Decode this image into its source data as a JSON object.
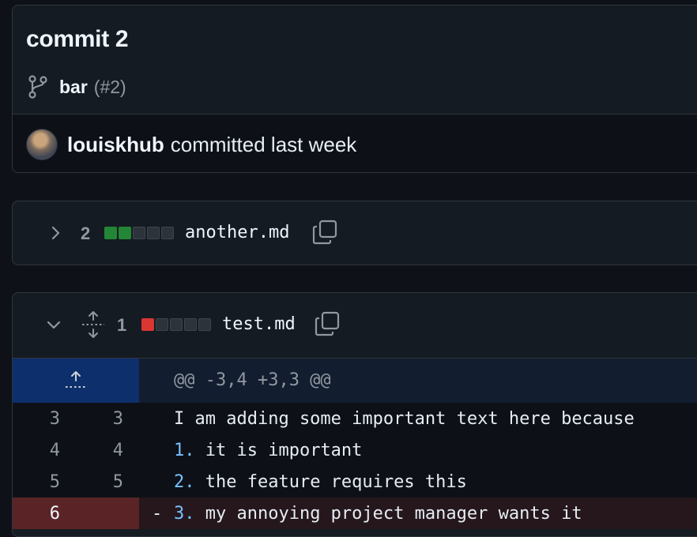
{
  "commit": {
    "title": "commit 2",
    "branch_name": "bar",
    "pr_ref": "(#2)",
    "author": "louiskhub",
    "action": "committed last week"
  },
  "files": [
    {
      "change_count": "2",
      "diffstat": [
        "add",
        "add",
        "neutral",
        "neutral",
        "neutral"
      ],
      "name": "another.md",
      "expanded": false
    },
    {
      "change_count": "1",
      "diffstat": [
        "del",
        "neutral",
        "neutral",
        "neutral",
        "neutral"
      ],
      "name": "test.md",
      "expanded": true,
      "hunk": "@@ -3,4 +3,3 @@",
      "lines": [
        {
          "old": "3",
          "new": "3",
          "type": "context",
          "marker": "",
          "text": "I am adding some important text here because"
        },
        {
          "old": "4",
          "new": "4",
          "type": "context",
          "marker": "1.",
          "text": " it is important"
        },
        {
          "old": "5",
          "new": "5",
          "type": "context",
          "marker": "2.",
          "text": " the feature requires this"
        },
        {
          "old": "6",
          "new": "",
          "type": "deletion",
          "sign": "-",
          "marker": "3.",
          "text": " my annoying project manager wants it"
        }
      ]
    }
  ],
  "colors": {
    "background": "#0e1117",
    "addition": "#238636",
    "deletion": "#da3633",
    "hunk_gutter": "#0d2f6b",
    "deleted_gutter": "#5a2427",
    "list_marker": "#79c0ff"
  },
  "icons": [
    "git-branch-icon",
    "avatar",
    "chevron-right-icon",
    "chevron-down-icon",
    "copy-icon",
    "expand-vertical-icon",
    "expand-up-icon"
  ]
}
